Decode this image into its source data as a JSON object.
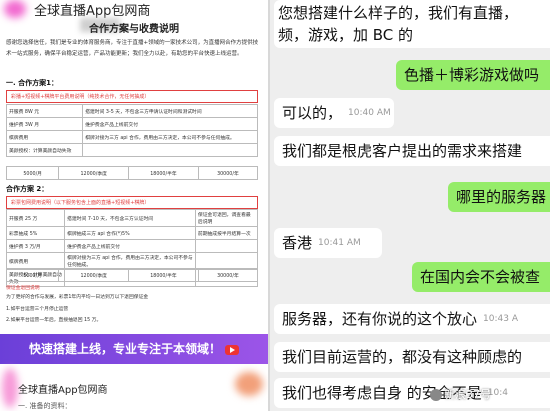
{
  "left": {
    "header": "全球直播App包网商",
    "doc_title": "合作方案与收费说明",
    "intro": "感谢您选择信任，我们是专业的体育服务商，专注于直播+领域的一家技术公司，为直播网合作方提供技术一站式服务，确保平台稳定运营，产品功能更新；我们全力以赴，有助您的平台快速上线运营。",
    "sec1": "一. 合作方案1：",
    "box1": "彩播+短视频+棋牌平台费用说明（纯技术合作，无任何抽成）",
    "table1": [
      [
        "开服费 8W 元",
        "搭建时间 3-5 天，不包含三方申请认证时间和测试时间"
      ],
      [
        "维护费 3W 月",
        "维护费含产品上线前交付"
      ],
      [
        "棋牌费用",
        "棋牌对接为三方 api 合作，费用由三方决定，本公司不参与任何抽成。"
      ],
      [
        "美颜授权：计算美颜自动失效",
        ""
      ]
    ],
    "prices1": [
      "5000/月",
      "12000/季度",
      "18000/半年",
      "30000/年"
    ],
    "sec2": "合作方案 2：",
    "box2": "彩票包网费用说明（以下服务包含上面的直播+短视频+棋牌）",
    "table2": [
      [
        "开服费 25 万",
        "搭建时间 7-10 天，不包含三方认证时间",
        "保证金可退回，调查看最后说明"
      ],
      [
        "彩票抽成 5%",
        "棋牌抽成三方 api 合作(*)5%",
        "前期抽成按半月结算一次"
      ],
      [
        "维护费 3 万/月",
        "维护费含产品上线前交付",
        ""
      ],
      [
        "棋牌费用",
        "棋牌对接为三方 api 合作，费用由三方决定，本公司不参与任何抽成。",
        ""
      ],
      [
        "美颜授权：计算美颜自动失效",
        "",
        ""
      ]
    ],
    "prices2": [
      "5000/月",
      "12000/季度",
      "18000/半年",
      "30000/年"
    ],
    "guarantee_title": "保证金退回说明",
    "guarantee": "为了更好的合作与发展，彩票1年内平均一日达到万以下退回保证金",
    "rule1": "1.如平台运营三个月停止运营",
    "rule2": "2.如果平台运营一年后，直接抽退回 15 万。",
    "banner": "快速搭建上线，专业专注于本领域！",
    "bottom_header": "全球直播App包网商",
    "bottom_sub": "一. 准备的资料："
  },
  "chat": {
    "m1_line1": "您想搭建什么样子的，我们有直播，",
    "m1_line2": "频，游戏，加 BC 的",
    "m2": "色播＋博彩游戏做吗",
    "m3": "可以的，",
    "m3_time": "10:40 AM",
    "m4": "我们都是根虎客户提出的需求来搭建",
    "m5": "哪里的服务器",
    "m6": "香港",
    "m6_time": "10:41 AM",
    "m7": "在国内会不会被查",
    "m8": "服务器，还有你说的这个放心",
    "m8_time": "10:43 A",
    "m9": "我们目前运营的，都没有这种顾虑的",
    "m10": "我们也得考虑自身 的安全不是",
    "m10_time": "10:4",
    "watermark": "新浪37号"
  },
  "colors": {
    "out_bubble": "#95ec69",
    "in_bubble": "#ffffff",
    "banner": "#7b45de",
    "red": "#e04040"
  }
}
